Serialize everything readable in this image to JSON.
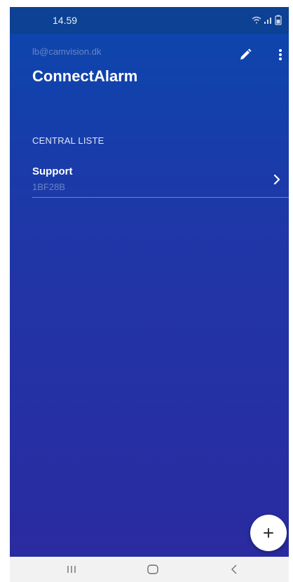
{
  "status_bar": {
    "time": "14.59",
    "icons": [
      "wifi-icon",
      "signal-icon",
      "battery-icon"
    ]
  },
  "header": {
    "email": "lb@camvision.dk",
    "title": "ConnectAlarm",
    "actions": [
      "edit-icon",
      "more-vert-icon"
    ]
  },
  "section": {
    "label": "CENTRAL LISTE"
  },
  "list": {
    "items": [
      {
        "title": "Support",
        "subtitle": "1BF28B"
      }
    ]
  },
  "fab": {
    "icon": "plus-icon"
  },
  "nav_bar": {
    "icons": [
      "recent-apps-icon",
      "home-icon",
      "back-icon"
    ]
  },
  "colors": {
    "gradient_top": "#0b47ad",
    "gradient_bottom": "#2a2ba0",
    "status_bar": "#0c4193",
    "muted_text": "#6b86c4"
  }
}
